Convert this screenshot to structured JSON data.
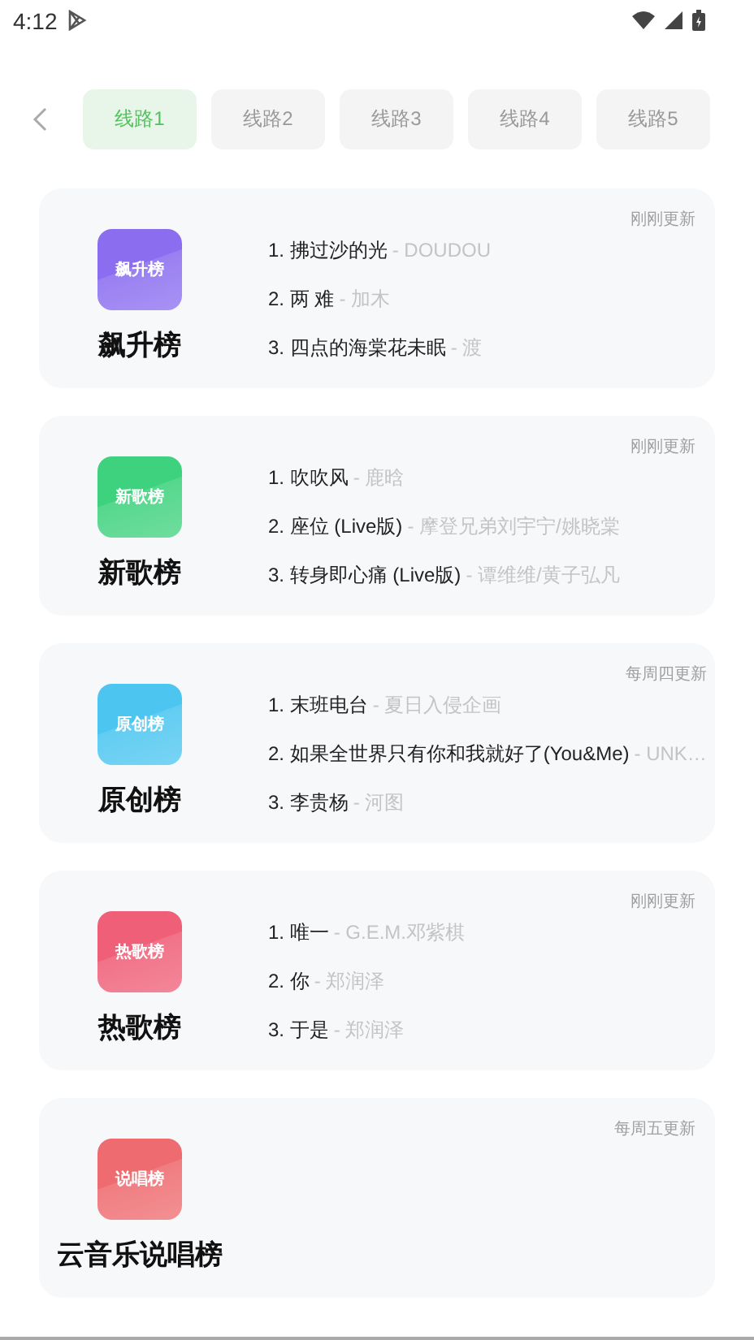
{
  "status_bar": {
    "time": "4:12"
  },
  "tabs": [
    {
      "label": "线路1",
      "selected": true
    },
    {
      "label": "线路2",
      "selected": false
    },
    {
      "label": "线路3",
      "selected": false
    },
    {
      "label": "线路4",
      "selected": false
    },
    {
      "label": "线路5",
      "selected": false
    }
  ],
  "charts": [
    {
      "cover_label": "飙升榜",
      "color": "#8b6ef0",
      "title": "飙升榜",
      "updated": "刚刚更新",
      "songs": [
        {
          "title": "1. 拂过沙的光",
          "artist": "- DOUDOU"
        },
        {
          "title": "2. 两 难",
          "artist": "- 加木"
        },
        {
          "title": "3. 四点的海棠花未眠",
          "artist": "- 渡"
        }
      ]
    },
    {
      "cover_label": "新歌榜",
      "color": "#3fd27e",
      "title": "新歌榜",
      "updated": "刚刚更新",
      "songs": [
        {
          "title": "1. 吹吹风",
          "artist": "- 鹿晗"
        },
        {
          "title": "2. 座位 (Live版)",
          "artist": "- 摩登兄弟刘宇宁/姚晓棠"
        },
        {
          "title": "3. 转身即心痛 (Live版)",
          "artist": "- 谭维维/黄子弘凡"
        }
      ]
    },
    {
      "cover_label": "原创榜",
      "color": "#4cc6f0",
      "title": "原创榜",
      "updated": "每周四更新",
      "songs": [
        {
          "title": "1. 末班电台",
          "artist": "- 夏日入侵企画"
        },
        {
          "title": "2. 如果全世界只有你和我就好了(You&Me)",
          "artist": "- UNK…"
        },
        {
          "title": "3. 李贵杨",
          "artist": "- 河图"
        }
      ]
    },
    {
      "cover_label": "热歌榜",
      "color": "#ef5f78",
      "title": "热歌榜",
      "updated": "刚刚更新",
      "songs": [
        {
          "title": "1. 唯一",
          "artist": "- G.E.M.邓紫棋"
        },
        {
          "title": "2. 你",
          "artist": "- 郑润泽"
        },
        {
          "title": "3. 于是",
          "artist": "- 郑润泽"
        }
      ]
    },
    {
      "cover_label": "说唱榜",
      "color": "#ee6b6f",
      "title": "云音乐说唱榜",
      "updated": "每周五更新"
    }
  ]
}
